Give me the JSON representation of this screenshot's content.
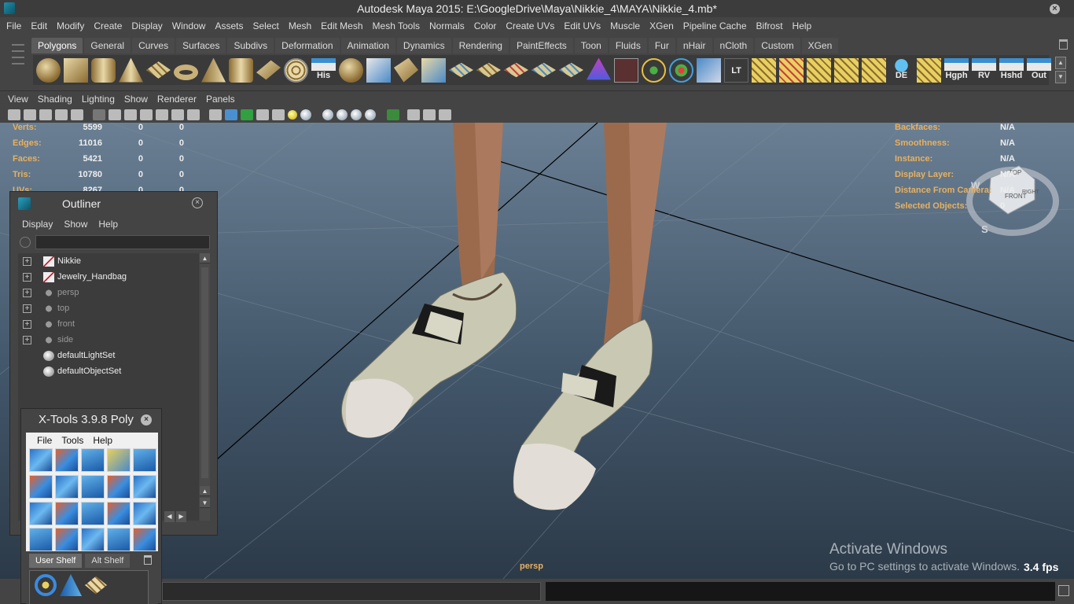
{
  "window": {
    "title": "Autodesk Maya 2015: E:\\GoogleDrive\\Maya\\Nikkie_4\\MAYA\\Nikkie_4.mb*",
    "close_icon": "close-icon"
  },
  "main_menu": [
    "File",
    "Edit",
    "Modify",
    "Create",
    "Display",
    "Window",
    "Assets",
    "Select",
    "Mesh",
    "Edit Mesh",
    "Mesh Tools",
    "Normals",
    "Color",
    "Create UVs",
    "Edit UVs",
    "Muscle",
    "XGen",
    "Pipeline Cache",
    "Bifrost",
    "Help"
  ],
  "shelf": {
    "tabs": [
      "Polygons",
      "General",
      "Curves",
      "Surfaces",
      "Subdivs",
      "Deformation",
      "Animation",
      "Dynamics",
      "Rendering",
      "PaintEffects",
      "Toon",
      "Fluids",
      "Fur",
      "nHair",
      "nCloth",
      "Custom",
      "XGen"
    ],
    "active_tab": "Polygons",
    "text_icons": {
      "his": "His",
      "lt": "LT",
      "de": "DE",
      "hgph": "Hgph",
      "rv": "RV",
      "hshd": "Hshd",
      "out": "Out"
    }
  },
  "viewport_menu": [
    "View",
    "Shading",
    "Lighting",
    "Show",
    "Renderer",
    "Panels"
  ],
  "hud_left": [
    {
      "label": "Verts:",
      "v1": "5599",
      "v2": "0",
      "v3": "0"
    },
    {
      "label": "Edges:",
      "v1": "11016",
      "v2": "0",
      "v3": "0"
    },
    {
      "label": "Faces:",
      "v1": "5421",
      "v2": "0",
      "v3": "0"
    },
    {
      "label": "Tris:",
      "v1": "10780",
      "v2": "0",
      "v3": "0"
    },
    {
      "label": "UVs:",
      "v1": "8267",
      "v2": "0",
      "v3": "0"
    }
  ],
  "hud_right": [
    {
      "label": "Backfaces:",
      "value": "N/A"
    },
    {
      "label": "Smoothness:",
      "value": "N/A"
    },
    {
      "label": "Instance:",
      "value": "N/A"
    },
    {
      "label": "Display Layer:",
      "value": "N/A"
    },
    {
      "label": "Distance From Camera:",
      "value": "N/A"
    },
    {
      "label": "Selected Objects:",
      "value": "0"
    }
  ],
  "viewcube": {
    "top": "TOP",
    "front": "FRONT",
    "right": "RIGHT",
    "south": "S",
    "west": "W"
  },
  "camera_label": "persp",
  "watermark": {
    "line1": "Activate Windows",
    "line2": "Go to PC settings to activate Windows."
  },
  "fps": "3.4 fps",
  "outliner": {
    "title": "Outliner",
    "menu": [
      "Display",
      "Show",
      "Help"
    ],
    "items": [
      {
        "label": "Nikkie",
        "icon": "mesh",
        "expandable": true
      },
      {
        "label": "Jewelry_Handbag",
        "icon": "mesh",
        "expandable": true
      },
      {
        "label": "persp",
        "icon": "camera",
        "expandable": true
      },
      {
        "label": "top",
        "icon": "camera",
        "expandable": true
      },
      {
        "label": "front",
        "icon": "camera",
        "expandable": true
      },
      {
        "label": "side",
        "icon": "camera",
        "expandable": true
      },
      {
        "label": "defaultLightSet",
        "icon": "set",
        "expandable": false
      },
      {
        "label": "defaultObjectSet",
        "icon": "set",
        "expandable": false
      }
    ]
  },
  "xtools": {
    "title": "X-Tools 3.9.8 Poly",
    "menu": [
      "File",
      "Tools",
      "Help"
    ],
    "shelf_tabs": [
      "User Shelf",
      "Alt Shelf"
    ],
    "active_shelf_tab": "User Shelf"
  }
}
